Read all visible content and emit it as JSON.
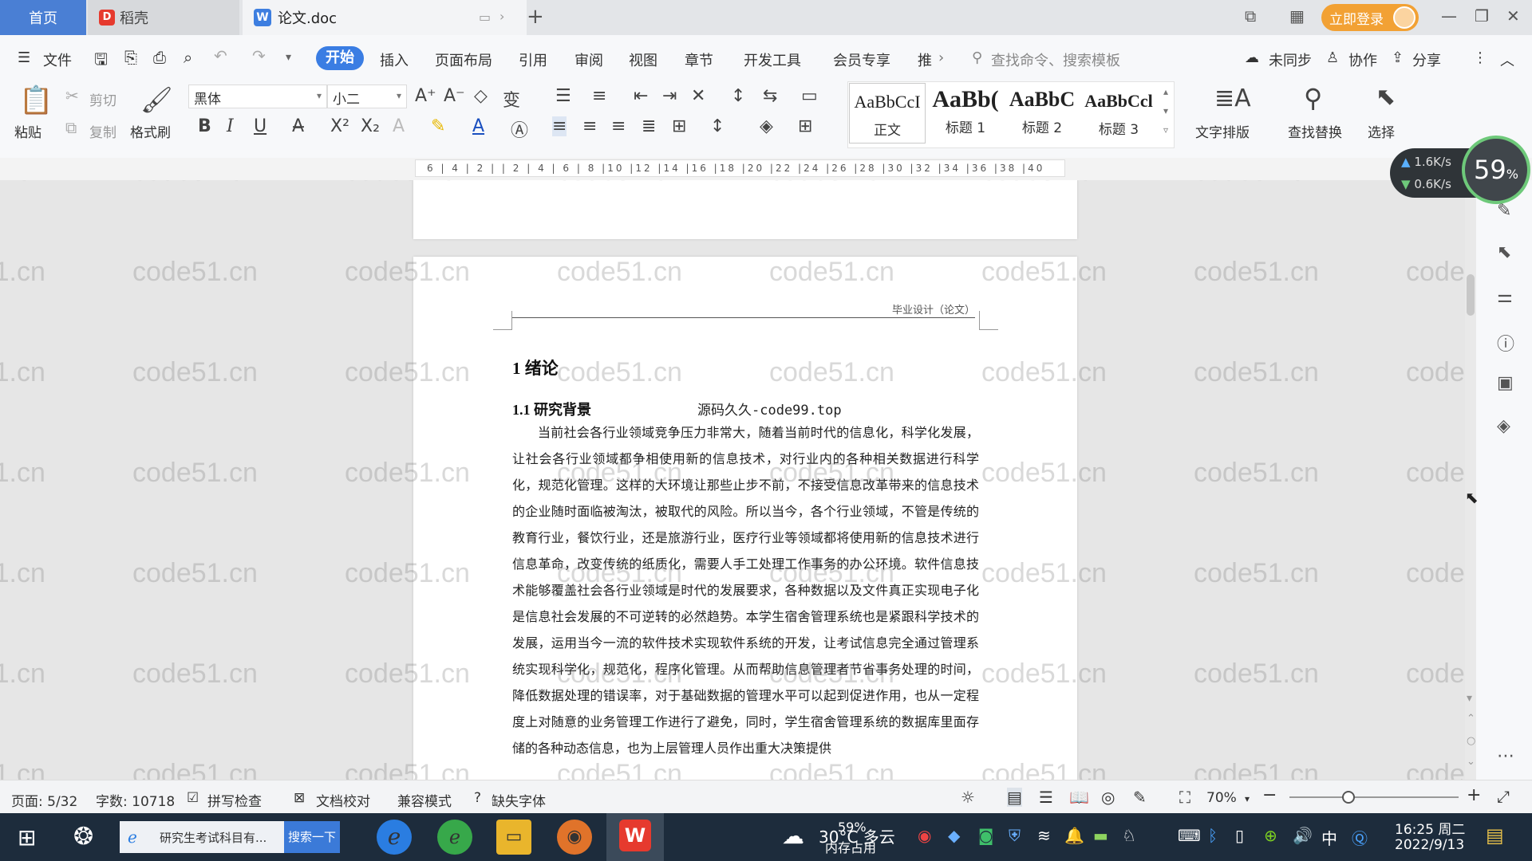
{
  "titlebar": {
    "tab_home": "首页",
    "tab_daoke": "稻壳",
    "tab_doc": "论文.doc",
    "new_tab": "+",
    "login": "立即登录",
    "min": "—",
    "max": "❐",
    "close": "✕"
  },
  "menubar": {
    "file": "文件",
    "items": [
      "开始",
      "插入",
      "页面布局",
      "引用",
      "审阅",
      "视图",
      "章节",
      "开发工具",
      "会员专享",
      "推"
    ],
    "search_cmd": "查找命令、搜索模板",
    "sync": "未同步",
    "collab": "协作",
    "share": "分享"
  },
  "ribbon": {
    "paste": "粘贴",
    "cut": "剪切",
    "copy": "复制",
    "format_painter": "格式刷",
    "font_name": "黑体",
    "font_size": "小二",
    "styles": [
      {
        "sample": "AaBbCcI",
        "name": "正文"
      },
      {
        "sample": "AaBb(",
        "name": "标题 1"
      },
      {
        "sample": "AaBbC",
        "name": "标题 2"
      },
      {
        "sample": "AaBbCcl",
        "name": "标题 3"
      }
    ],
    "text_layout": "文字排版",
    "find_replace": "查找替换",
    "select": "选择"
  },
  "ruler": {
    "ticks": "6 | 4 | 2 | | 2 | 4 | 6 | 8 |10 |12 |14 |16 |18 |20 |22 |24 |26 |28 |30 |32 |34 |36 |38 |40"
  },
  "watermark": "code51.cn",
  "document": {
    "header_text": "毕业设计（论文）",
    "chapter_title": "1  绪论",
    "section_title": "1.1  研究背景",
    "source_note": "源码久久-code99.top",
    "paragraph": "当前社会各行业领域竞争压力非常大，随着当前时代的信息化，科学化发展，让社会各行业领域都争相使用新的信息技术，对行业内的各种相关数据进行科学化，规范化管理。这样的大环境让那些止步不前，不接受信息改革带来的信息技术的企业随时面临被淘汰，被取代的风险。所以当今，各个行业领域，不管是传统的教育行业，餐饮行业，还是旅游行业，医疗行业等领域都将使用新的信息技术进行信息革命，改变传统的纸质化，需要人手工处理工作事务的办公环境。软件信息技术能够覆盖社会各行业领域是时代的发展要求，各种数据以及文件真正实现电子化是信息社会发展的不可逆转的必然趋势。本学生宿舍管理系统也是紧跟科学技术的发展，运用当今一流的软件技术实现软件系统的开发，让考试信息完全通过管理系统实现科学化，规范化，程序化管理。从而帮助信息管理者节省事务处理的时间，降低数据处理的错误率，对于基础数据的管理水平可以起到促进作用，也从一定程度上对随意的业务管理工作进行了避免，同时，学生宿舍管理系统的数据库里面存储的各种动态信息，也为上层管理人员作出重大决策提供"
  },
  "speed_widget": {
    "up": "1.6K/s",
    "down": "0.6K/s",
    "percent": "59",
    "percent_unit": "%"
  },
  "statusbar": {
    "page": "页面: 5/32",
    "words": "字数: 10718",
    "spell": "拼写检查",
    "proof": "文档校对",
    "compat": "兼容模式",
    "missing_font": "缺失字体",
    "zoom": "70%",
    "zoom_level": 0.35
  },
  "taskbar": {
    "search_text": "研究生考试科目有...",
    "search_btn": "搜索一下",
    "weather": "30°C 多云",
    "mem_pct": "59%",
    "mem_label": "内存占用",
    "ime": "中",
    "time": "16:25 周二",
    "date": "2022/9/13"
  }
}
